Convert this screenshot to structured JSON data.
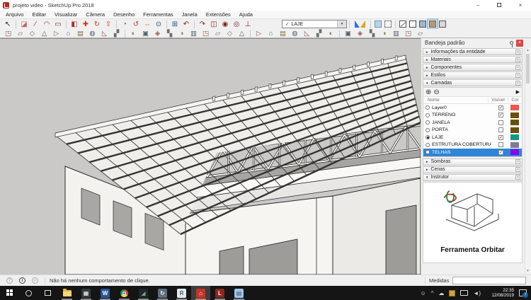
{
  "window": {
    "title": "projeto video - SketchUp Pro 2018",
    "minimize_glyph": "–",
    "close_glyph": "×"
  },
  "menu_items": [
    "Arquivo",
    "Editar",
    "Visualizar",
    "Câmera",
    "Desenho",
    "Ferramentas",
    "Janela",
    "Extensões",
    "Ajuda"
  ],
  "toolbar": {
    "layer_dropdown": {
      "checkmark": "✓",
      "value": "LAJE",
      "arrow": "▼"
    },
    "row1": [
      {
        "name": "select-tool-icon",
        "glyph": "↖",
        "color": "#222222"
      },
      {
        "name": "eraser-tool-icon",
        "glyph": "◪",
        "color": "#bc6a5a",
        "sep": true
      },
      {
        "name": "line-tool-icon",
        "glyph": "∕",
        "color": "#8d2f25"
      },
      {
        "name": "arc-tool-icon",
        "glyph": "◠",
        "color": "#8d2f25"
      },
      {
        "name": "rectangle-tool-icon",
        "glyph": "▭",
        "color": "#8d2f25"
      },
      {
        "name": "paint-bucket-tool-icon",
        "glyph": "◧",
        "color": "#a93226",
        "sep": true
      },
      {
        "name": "move-tool-icon",
        "glyph": "✚",
        "color": "#c0392b"
      },
      {
        "name": "rotate-tool-icon",
        "glyph": "↻",
        "color": "#c0392b"
      },
      {
        "name": "push-pull-tool-icon",
        "glyph": "⇧",
        "color": "#c0392b"
      },
      {
        "name": "offset-tool-icon",
        "glyph": "◔",
        "color": "#c0392b",
        "sep": true
      },
      {
        "name": "orbit-tool-icon",
        "glyph": "↺",
        "color": "#b03a2e"
      },
      {
        "name": "pan-tool-icon",
        "glyph": "⇔",
        "color": "#b7950b"
      },
      {
        "name": "zoom-tool-icon",
        "glyph": "⊙",
        "color": "#1a5276"
      },
      {
        "name": "zoom-extents-tool-icon",
        "glyph": "⊞",
        "color": "#1a5276",
        "sep": true
      },
      {
        "name": "previous-view-icon",
        "glyph": "↶",
        "color": "#7b241c"
      },
      {
        "name": "next-view-icon",
        "glyph": "↷",
        "color": "#7b241c",
        "sep": true
      },
      {
        "name": "section-plane-icon",
        "glyph": "◫",
        "color": "#7b241c"
      },
      {
        "name": "position-camera-icon",
        "glyph": "◉",
        "color": "#7b241c"
      },
      {
        "name": "look-around-icon",
        "glyph": "◎",
        "color": "#7b241c"
      },
      {
        "name": "walk-tool-icon",
        "glyph": "⊥",
        "color": "#7b241c"
      }
    ],
    "face_styles": [
      {
        "name": "xray-style-icon",
        "bg": "rgba(130,175,220,0.45)",
        "bd": "#7593ad"
      },
      {
        "name": "back-edges-style-icon",
        "bg": "#f5f5f5",
        "bd": "#777777",
        "dash": true
      },
      {
        "name": "wireframe-style-icon",
        "bg": "#ffffff",
        "bd": "#555555",
        "wire": true,
        "sep": true
      },
      {
        "name": "hidden-line-style-icon",
        "bg": "#ffffff",
        "bd": "#444444"
      },
      {
        "name": "shaded-style-icon",
        "bg": "#9fb6c9",
        "bd": "#44576b"
      },
      {
        "name": "shaded-textures-style-icon",
        "bg": "#b59b7a",
        "bd": "#6e5a3f",
        "active": true
      },
      {
        "name": "monochrome-style-icon",
        "bg": "#d9d9d9",
        "bd": "#555555"
      }
    ],
    "row2": {
      "count": 34,
      "seps": [
        10,
        20,
        27
      ],
      "glyphs": [
        "◳",
        "▱",
        "◇",
        "△",
        "▷",
        "⌂",
        "▤",
        "◍",
        "◺",
        "▞",
        "◐",
        "▣",
        "◈",
        "▚",
        "◑",
        "▥"
      ],
      "colors": [
        "#96564a",
        "#6d6d6d",
        "#8a6d3b",
        "#555f66"
      ]
    }
  },
  "tray": {
    "title": "Bandeja padrão",
    "sections_top": [
      {
        "label": "Informações da entidade",
        "expanded": false
      },
      {
        "label": "Materiais",
        "expanded": false
      },
      {
        "label": "Componentes",
        "expanded": false
      },
      {
        "label": "Estilos",
        "expanded": false
      },
      {
        "label": "Camadas",
        "expanded": true
      }
    ],
    "sections_bottom": [
      {
        "label": "Sombras",
        "expanded": false
      },
      {
        "label": "Cenas",
        "expanded": false
      },
      {
        "label": "Instrutor",
        "expanded": true
      }
    ],
    "layers": {
      "columns": [
        "Nome",
        "Visível",
        "Cor"
      ],
      "rows": [
        {
          "name": "Layer0",
          "radio": false,
          "visible": true,
          "color": "#f0554e",
          "selected": false
        },
        {
          "name": "TERRENO",
          "radio": false,
          "visible": true,
          "color": "#6b4e07",
          "selected": false
        },
        {
          "name": "JANELA",
          "radio": false,
          "visible": false,
          "color": "#6b4e07",
          "selected": false
        },
        {
          "name": "PORTA",
          "radio": false,
          "visible": false,
          "color": "#6b4e07",
          "selected": false
        },
        {
          "name": "LAJE",
          "radio": true,
          "visible": true,
          "color": "#0b9b80",
          "selected": false
        },
        {
          "name": "ESTRUTURA COBERTURA",
          "radio": false,
          "visible": false,
          "color": "#7c7c95",
          "selected": false
        },
        {
          "name": "TELHAS",
          "radio": false,
          "visible": true,
          "color": "#8a00f0",
          "selected": true
        }
      ]
    },
    "instructor_title": "Ferramenta Orbitar"
  },
  "statusbar": {
    "message": "Não há nenhum comportamento de clique.",
    "measurements_label": "Medidas",
    "measurements_value": ""
  },
  "taskbar": {
    "time": "22:35",
    "date": "12/08/2019",
    "notification_count": "7",
    "icons": [
      {
        "name": "start-button",
        "kind": "win"
      },
      {
        "name": "cortana-search-button",
        "kind": "circle"
      },
      {
        "name": "task-view-button",
        "kind": "taskview"
      },
      {
        "name": "file-explorer-icon",
        "kind": "folder",
        "running": true
      },
      {
        "name": "calculator-icon",
        "kind": "tile",
        "bg": "#333a40",
        "glyph": "▦",
        "fg": "#ffffff",
        "running": true
      },
      {
        "name": "word-icon",
        "kind": "tile",
        "bg": "#2b579a",
        "glyph": "W",
        "fg": "#ffffff",
        "running": true
      },
      {
        "name": "chrome-icon",
        "kind": "chrome",
        "running": true
      },
      {
        "name": "photos-icon",
        "kind": "tile",
        "bg": "#20262b",
        "glyph": "◢",
        "fg": "#6fae72",
        "running": true
      },
      {
        "name": "sync-settings-icon",
        "kind": "tile",
        "bg": "#5d6d7e",
        "glyph": "↻",
        "fg": "#ffffff",
        "running": true
      },
      {
        "name": "rstudio-icon",
        "kind": "tile",
        "bg": "#e9e9e9",
        "glyph": "R",
        "fg": "#2468a4",
        "running": true
      },
      {
        "name": "sketchup-icon",
        "kind": "tile",
        "bg": "#c7342a",
        "glyph": "⌂",
        "fg": "#ffffff",
        "running": true,
        "active": true
      },
      {
        "name": "layout-icon",
        "kind": "tile",
        "bg": "#8e2620",
        "glyph": "L",
        "fg": "#ffffff",
        "running": true
      },
      {
        "name": "notes-icon",
        "kind": "tile",
        "bg": "#9fc5e8",
        "glyph": "▤",
        "fg": "#34597d",
        "running": true
      }
    ]
  },
  "icons": {
    "check": "✓",
    "dropdown_arrow": "▼",
    "collapsed_arrow": "►",
    "expanded_arrow": "▼",
    "section_close": "×",
    "add_layer": "⊕",
    "remove_layer": "⊖",
    "details_arrow": "▶",
    "scroll_up": "▲",
    "scroll_down": "▼",
    "question": "?",
    "info": "i",
    "person": "☺",
    "caret": "^",
    "cloud": "☁",
    "speaker": "◄)"
  },
  "colors": {
    "selection_blue": "#2f86d6",
    "viewport_gray": "#cac9c7",
    "taskbar_black": "#151515"
  }
}
